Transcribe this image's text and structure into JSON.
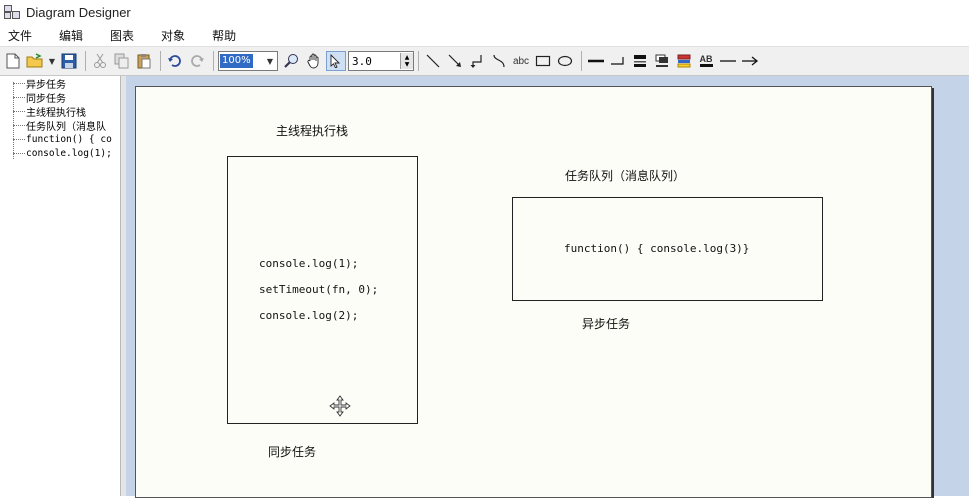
{
  "window": {
    "title": "Diagram Designer"
  },
  "menu": {
    "items": [
      "文件",
      "编辑",
      "图表",
      "对象",
      "帮助"
    ]
  },
  "toolbar": {
    "zoom_value": "100%",
    "line_width_value": "3.0",
    "text_tool_label": "abc",
    "font_tool_label": "AB"
  },
  "tree": {
    "items": [
      "异步任务",
      "同步任务",
      "主线程执行栈",
      "任务队列（消息队",
      "function() {  co",
      "console.log(1);"
    ]
  },
  "diagram": {
    "main_stack_title": "主线程执行栈",
    "main_stack_lines": [
      "console.log(1);",
      "setTimeout(fn, 0);",
      "console.log(2);"
    ],
    "sync_label": "同步任务",
    "queue_title": "任务队列（消息队列）",
    "queue_content": "function()  {   console.log(3)}",
    "async_label": "异步任务"
  }
}
